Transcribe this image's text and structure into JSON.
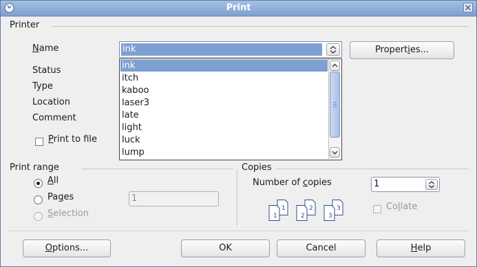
{
  "window": {
    "title": "Print"
  },
  "printer": {
    "section_title": "Printer",
    "name_label": "Name",
    "status_label": "Status",
    "type_label": "Type",
    "location_label": "Location",
    "comment_label": "Comment",
    "selected_printer": "ink",
    "properties_button": "Properties...",
    "print_to_file_label": "Print to file",
    "print_to_file_checked": false,
    "dropdown_options": [
      "ink",
      "itch",
      "kaboo",
      "laser3",
      "late",
      "light",
      "luck",
      "lump"
    ],
    "dropdown_selected_index": 0
  },
  "print_range": {
    "section_title": "Print range",
    "all_label": "All",
    "pages_label": "Pages",
    "selection_label": "Selection",
    "selected": "All",
    "pages_value": "1"
  },
  "copies": {
    "section_title": "Copies",
    "number_label": "Number of copies",
    "number_value": "1",
    "collate_label": "Collate",
    "collate_checked": false,
    "page_icon_labels": [
      "1",
      "1",
      "2",
      "2",
      "3",
      "3"
    ]
  },
  "buttons": {
    "options": "Options...",
    "ok": "OK",
    "cancel": "Cancel",
    "help": "Help"
  },
  "colors": {
    "title_bar": "#8fb0db",
    "selection": "#7e9fd1",
    "dialog_bg": "#efefef"
  },
  "icons": {
    "window_icon": "app-icon",
    "close": "close-icon",
    "combo": "updown-chevron-icon",
    "scroll_up": "chevron-up-icon",
    "scroll_down": "chevron-down-icon"
  }
}
